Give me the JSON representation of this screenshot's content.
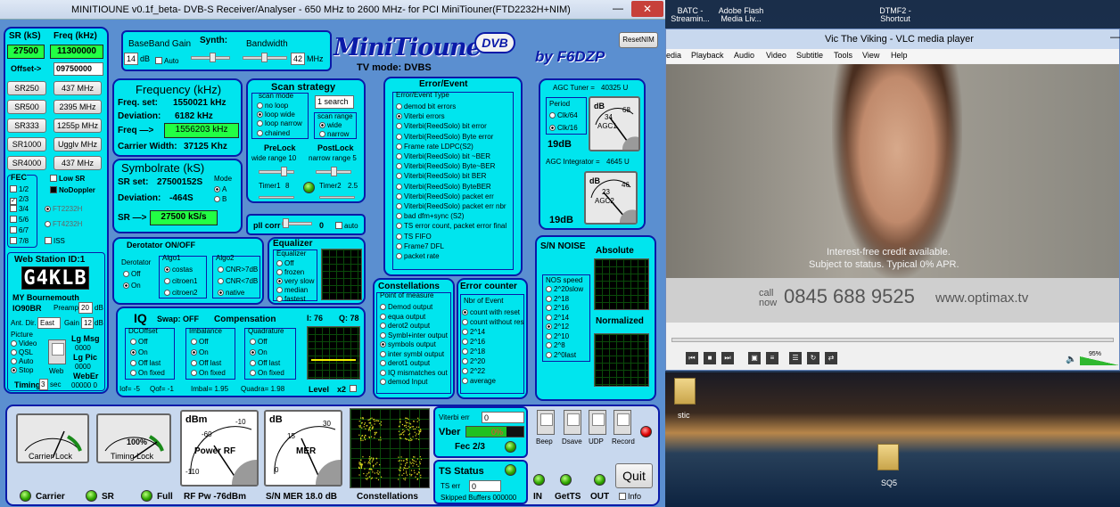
{
  "minitioune": {
    "title": "MINITIOUNE v0.1f_beta- DVB-S Receiver/Analyser - 650 MHz to 2600 MHz- for PCI MiniTiouner(FTD2232H+NIM)",
    "left": {
      "sr_label": "SR (kS)",
      "freq_label": "Freq (kHz)",
      "sr_value": "27500",
      "freq_value": "11300000",
      "offset_label": "Offset->",
      "offset_value": "09750000",
      "sr_buttons": [
        "SR250",
        "SR500",
        "SR333",
        "SR1000",
        "SR4000"
      ],
      "freq_buttons": [
        "437 MHz",
        "2395 MHz",
        "1255p MHz",
        "Ugglv MHz",
        "437 MHz"
      ],
      "fec_label": "FEC",
      "fec_items": [
        "1/2",
        "2/3",
        "3/4",
        "5/6",
        "6/7",
        "7/8"
      ],
      "fec_checked": "✓",
      "low_sr": "Low SR",
      "nodoppler": "NoDoppler",
      "ft2232": "FT2232H",
      "ft4232": "FT4232H",
      "iss": "ISS",
      "web_station": "Web Station ID:1",
      "callsign": "G4KLB",
      "location": "MY Bournemouth",
      "locator": "IO90BR",
      "preamp_label": "Preamp",
      "preamp_value": "20",
      "db": "dB",
      "ant_dir_label": "Ant. Dir.",
      "ant_dir_value": "East",
      "gain_label": "Gain",
      "gain_value": "12",
      "picture_label": "Picture",
      "picture_items": [
        "Video",
        "QSL",
        "Auto",
        "Stop"
      ],
      "web_label": "Web",
      "lg_msg": "Lg Msg",
      "lg_msg_value": "0000",
      "lg_pic": "Lg Pic",
      "lg_pic_value": "0000",
      "webe": "WebEr",
      "webe_value": "00000  0",
      "timing_label": "Timing",
      "timing_value": "3",
      "sec": "sec"
    },
    "baseband": {
      "label": "BaseBand Gain",
      "value": "14",
      "db": "dB",
      "auto": "Auto",
      "synth": "Synth:",
      "bandwidth": "Bandwidth",
      "bw_value": "42",
      "mhz": "MHz"
    },
    "logo": "MiniTioune",
    "logo_badge": "DVB",
    "tv_mode": "TV mode:   DVBS",
    "by": "by F6DZP",
    "reset": "ResetNIM",
    "frequency": {
      "title": "Frequency (kHz)",
      "set_label": "Freq. set:",
      "set_value": "1550021 kHz",
      "dev_label": "Deviation:",
      "dev_value": "6182 kHz",
      "freq_arrow": "Freq —>",
      "freq_value": "1556203 kHz",
      "cw_label": "Carrier Width:",
      "cw_value": "37125 Khz"
    },
    "symbolrate": {
      "title": "Symbolrate (kS)",
      "set_label": "SR set:",
      "set_value": "27500152S",
      "dev_label": "Deviation:",
      "dev_value": "-464S",
      "mode": "Mode",
      "mode_a": "A",
      "mode_b": "B",
      "sr_arrow": "SR —>",
      "sr_value": "27500 kS/s"
    },
    "scan": {
      "title": "Scan strategy",
      "mode_label": "scan mode",
      "modes": [
        "no loop",
        "loop wide",
        "loop narrow",
        "chained"
      ],
      "search": "1 search",
      "range_label": "scan range",
      "ranges": [
        "wide",
        "narrow"
      ],
      "prelock": "PreLock",
      "postlock": "PostLock",
      "wide_range": "wide range  10",
      "narrow_range": "narrow range  5",
      "timer1": "Timer1",
      "timer1_value": "8",
      "timer2": "Timer2",
      "timer2_value": "2.5"
    },
    "pll": {
      "label": "pll corr",
      "value": "0",
      "auto": "auto"
    },
    "error_event": {
      "title": "Error/Event",
      "subtitle": "Error/Event Type",
      "items": [
        "demod bit errors",
        "Viterbi errors",
        "Viterbi(ReedSolo) bit error",
        "Viterbi(ReedSolo) Byte error",
        "Frame rate LDPC(S2)",
        "Viterbi(ReedSolo) bit ~BER",
        "Viterbi(ReedSolo) Byte~BER",
        "Viterbi(ReedSolo) bit BER",
        "Viterbi(ReedSolo) ByteBER",
        "Viterbi(ReedSolo) packet err",
        "Viterbi(ReedSolo) packet err nbr",
        "bad dfm+sync (S2)",
        "TS error count, packet error final",
        "TS FIFO",
        "Frame7 DFL",
        "packet rate"
      ]
    },
    "agc": {
      "tuner_label": "AGC Tuner =",
      "tuner_value": "40325 U",
      "period": "Period",
      "clk64": "Clk/64",
      "clk16": "Clk/16",
      "agc1": "AGC1",
      "agc1_db": "19dB",
      "integrator_label": "AGC Integrator =",
      "integrator_value": "4645 U",
      "agc2": "AGC2",
      "agc2_db": "19dB",
      "db": "dB",
      "agc1_scale": [
        "34",
        "68"
      ],
      "agc2_scale": [
        "23",
        "46"
      ]
    },
    "derotator": {
      "title": "Derotator  ON/OFF",
      "derotator": "Derotator",
      "off": "Off",
      "on": "On",
      "algo1": "Algo1",
      "algo1_items": [
        "costas",
        "citroen1",
        "citroen2"
      ],
      "algo2": "Algo2",
      "algo2_items": [
        "CNR>7dB",
        "CNR<7dB",
        "native"
      ]
    },
    "equalizer": {
      "title": "Equalizer",
      "sub": "Equalizer",
      "items": [
        "Off",
        "frozen",
        "very slow",
        "median",
        "fastest"
      ]
    },
    "iq": {
      "title": "IQ",
      "swap": "Swap:  OFF",
      "compensation": "Compensation",
      "i_value": "I: 76",
      "q_value": "Q: 78",
      "dcoffset": "DCOffset",
      "imbalance": "Imbalance",
      "quadrature": "Quadrature",
      "dc_items": [
        "Off",
        "On",
        "Off last",
        "On fixed"
      ],
      "imb_items": [
        "Off",
        "On",
        "Off last",
        "On fixed"
      ],
      "quad_items": [
        "Off",
        "On",
        "Off last",
        "On fixed"
      ],
      "iof": "Iof= -5",
      "qof": "Qof= -1",
      "imbal": "Imbal= 1.95",
      "quadra": "Quadra= 1.98",
      "level": "Level",
      "x2": "x2"
    },
    "constellations": {
      "title": "Constellations",
      "sub": "Point of measure",
      "items": [
        "Demod output",
        "equa output",
        "derot2 output",
        "Symbl+inter output",
        "symbols output",
        "inter symbl output",
        "derot1 output",
        "IQ mismatches out",
        "demod Input"
      ]
    },
    "error_counter": {
      "title": "Error counter",
      "sub": "Nbr of Event",
      "items": [
        "count with reset",
        "count without res",
        "2^14",
        "2^16",
        "2^18",
        "2^20",
        "2^22",
        "average"
      ]
    },
    "sn": {
      "title": "S/N NOISE",
      "absolute": "Absolute",
      "normalized": "Normalized",
      "nos_speed": "NOS speed",
      "items": [
        "2^20slow",
        "2^18",
        "2^16",
        "2^14",
        "2^12",
        "2^10",
        "2^8",
        "2^0last"
      ]
    },
    "bottom": {
      "carrier_lock": "Carrier Lock",
      "timing_lock": "Timing Lock",
      "timing_pct": "100%",
      "power_rf": "Power RF",
      "dbm": "dBm",
      "mer": "MER",
      "db": "dB",
      "rf_scale": [
        "-60",
        "-10",
        "-110"
      ],
      "mer_scale": [
        "15",
        "30",
        "0"
      ],
      "carrier": "Carrier",
      "sr": "SR",
      "full": "Full",
      "rf_pw": "RF Pw  -76dBm",
      "sn_mer": "S/N MER  18.0 dB",
      "constellations": "Constellations",
      "viterbi_err": "Viterbi err",
      "viterbi_value": "0",
      "vber": "Vber",
      "vber_value": "0%",
      "fec": "Fec 2/3",
      "ts_status": "TS Status",
      "ts_err": "TS err",
      "ts_err_value": "0",
      "skipped": "Skipped Buffers 000000",
      "beep": "Beep",
      "dsave": "Dsave",
      "udp": "UDP",
      "record": "Record",
      "quit": "Quit",
      "in": "IN",
      "getts": "GetTS",
      "out": "OUT",
      "info": "Info"
    }
  },
  "desktop": {
    "icons": [
      {
        "label": "BATC - Streamin..."
      },
      {
        "label": "Adobe Flash Media Liv..."
      },
      {
        "label": "DTMF2 - Shortcut"
      }
    ],
    "folder1": "stic",
    "folder2": "SQ5"
  },
  "vlc": {
    "title": "Vic The Viking - VLC media player",
    "menu": [
      "edia",
      "Playback",
      "Audio",
      "Video",
      "Subtitle",
      "Tools",
      "View",
      "Help"
    ],
    "ad_line1": "Interest-free credit available.",
    "ad_line2": "Subject to status. Typical 0% APR.",
    "call_now": "call\nnow",
    "phone": "0845 688 9525",
    "website": "www.optimax.tv",
    "volume": "95%"
  },
  "colors": {
    "panel": "#00e5ee",
    "border": "#0a1aa8",
    "bg": "#5b8fd0",
    "led": "#2fa600",
    "lcd": "#22ff44"
  }
}
